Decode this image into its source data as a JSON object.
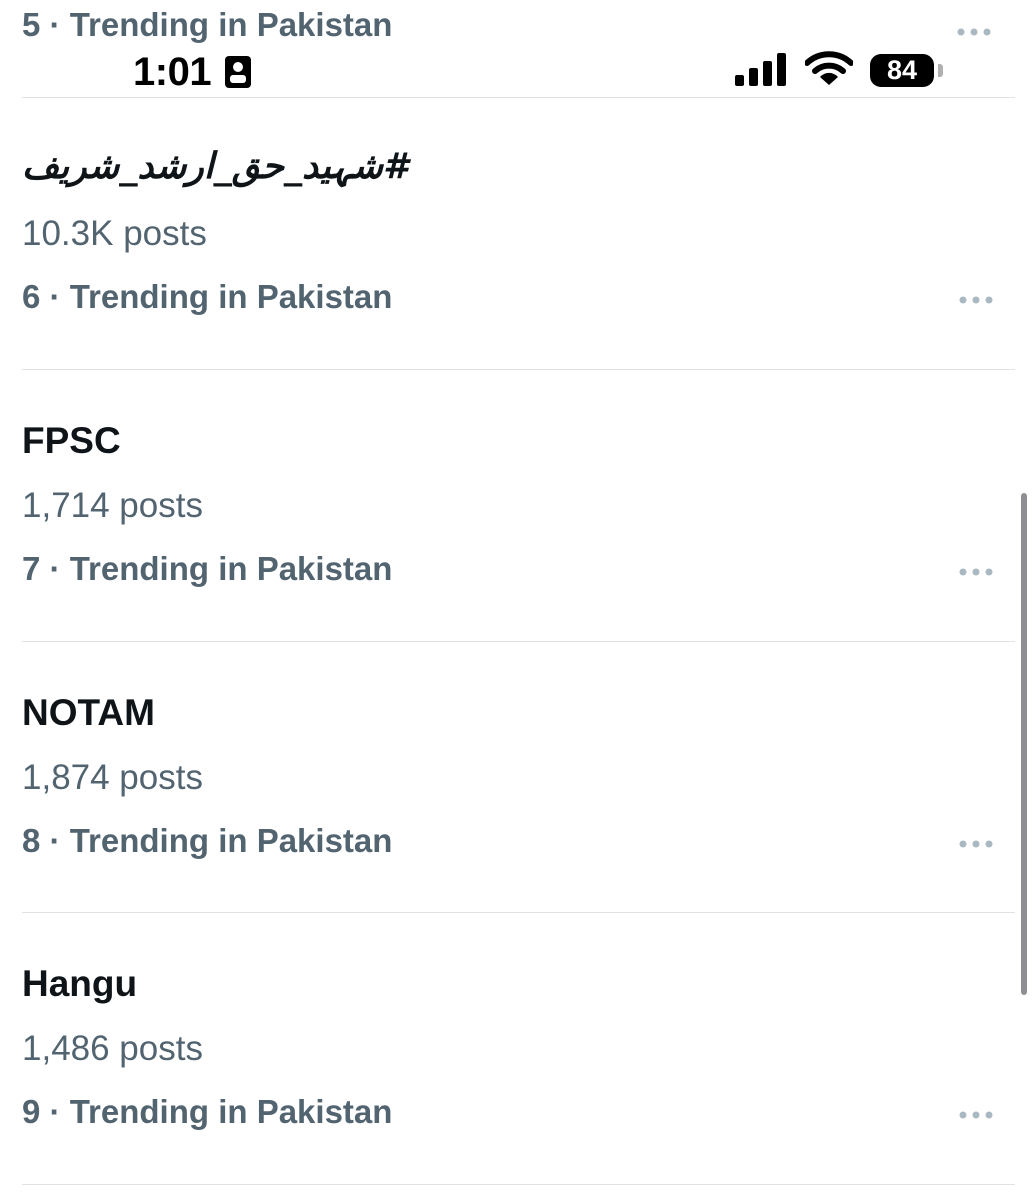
{
  "previous_trend": {
    "rank": "5",
    "separator": "·",
    "context": "Trending in Pakistan"
  },
  "status_bar": {
    "time": "1:01",
    "battery": "84"
  },
  "trends": [
    {
      "title": "#شہید_حق_ارشد_شریف",
      "posts": "10.3K posts",
      "rank": "6",
      "context": "Trending in Pakistan"
    },
    {
      "title": "FPSC",
      "posts": "1,714 posts",
      "rank": "7",
      "context": "Trending in Pakistan"
    },
    {
      "title": "NOTAM",
      "posts": "1,874 posts",
      "rank": "8",
      "context": "Trending in Pakistan"
    },
    {
      "title": "Hangu",
      "posts": "1,486 posts",
      "rank": "9",
      "context": "Trending in Pakistan"
    }
  ],
  "icons": {
    "more": "more-horizontal-icon",
    "signal": "cellular-signal-icon",
    "wifi": "wifi-icon",
    "id": "contact-card-icon"
  },
  "colors": {
    "text_primary": "#0f1419",
    "text_secondary": "#536471",
    "divider": "#dfe3e6",
    "more_dots": "#aab8c2"
  }
}
